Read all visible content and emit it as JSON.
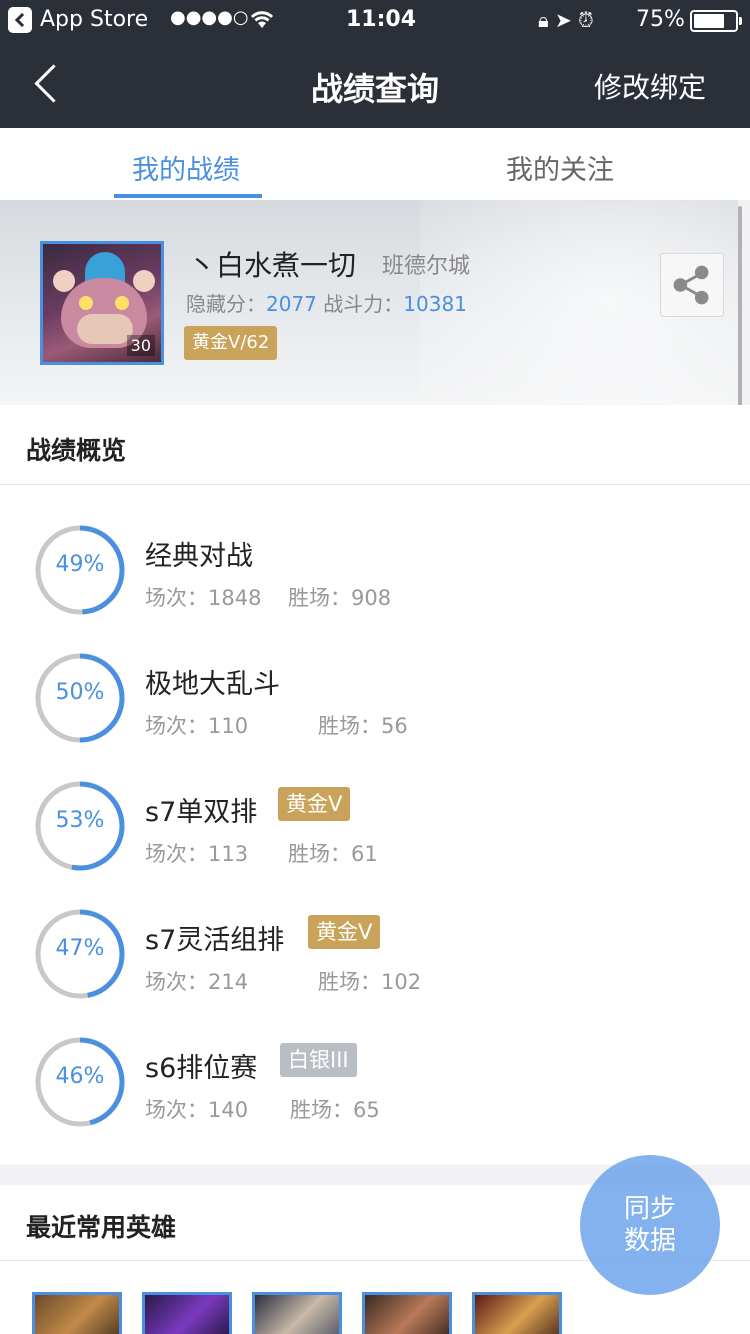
{
  "status_bar": {
    "carrier": "App Store",
    "signal": "●●●●○",
    "time": "11:04",
    "battery_pct": "75%",
    "battery_level": 0.75
  },
  "nav": {
    "title": "战绩查询",
    "right_action": "修改绑定"
  },
  "tabs": [
    {
      "label": "我的战绩",
      "active": true
    },
    {
      "label": "我的关注",
      "active": false
    }
  ],
  "profile": {
    "name": "丶白水煮一切",
    "server": "班德尔城",
    "level": "30",
    "hidden_score_label": "隐藏分：",
    "hidden_score": "2077",
    "power_label": "战斗力：",
    "power": "10381",
    "rank": "黄金V/62"
  },
  "overview": {
    "title": "战绩概览",
    "games_label": "场次：",
    "wins_label": "胜场：",
    "modes": [
      {
        "name": "经典对战",
        "rate": "49%",
        "rate_value": 0.49,
        "games": "1848",
        "wins": "908",
        "badge": "",
        "badge_type": ""
      },
      {
        "name": "极地大乱斗",
        "rate": "50%",
        "rate_value": 0.5,
        "games": "110",
        "wins": "56",
        "badge": "",
        "badge_type": ""
      },
      {
        "name": "s7单双排",
        "rate": "53%",
        "rate_value": 0.53,
        "games": "113",
        "wins": "61",
        "badge": "黄金V",
        "badge_type": "gold"
      },
      {
        "name": "s7灵活组排",
        "rate": "47%",
        "rate_value": 0.47,
        "games": "214",
        "wins": "102",
        "badge": "黄金V",
        "badge_type": "gold"
      },
      {
        "name": "s6排位赛",
        "rate": "46%",
        "rate_value": 0.46,
        "games": "140",
        "wins": "65",
        "badge": "白银III",
        "badge_type": "silver"
      }
    ]
  },
  "heroes": {
    "title": "最近常用英雄"
  },
  "sync_button": {
    "line1": "同步",
    "line2": "数据"
  },
  "colors": {
    "accent": "#4a8fe0",
    "nav_bg": "#2b2f38",
    "gold_badge": "#c9a35a",
    "silver_badge": "#b9bec4",
    "ring_track": "#c8c8c8"
  }
}
